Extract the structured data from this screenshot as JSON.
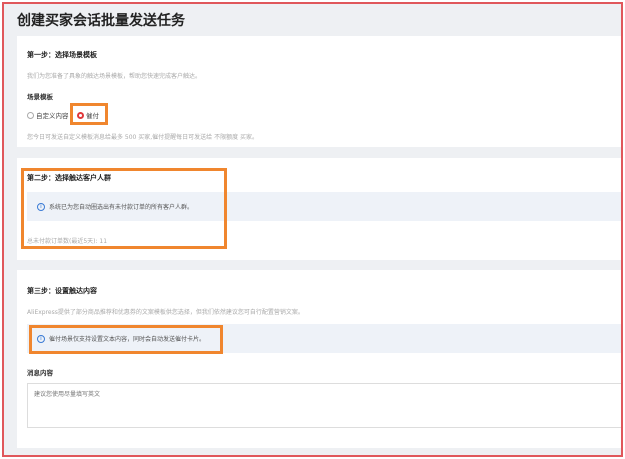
{
  "page": {
    "title": "创建买家会话批量发送任务"
  },
  "step1": {
    "title": "第一步：选择场景模板",
    "desc": "我们为您准备了具象的触达场景模板，帮助您快速完成客户触达。",
    "label": "场景模板",
    "options": [
      {
        "label": "自定义内容",
        "selected": false
      },
      {
        "label": "催付",
        "selected": true
      }
    ],
    "note": "您今日可发送自定义模板消息给最多 500 买家,催付提醒每日可发送给 不限额度 买家。"
  },
  "step2": {
    "title": "第二步：选择触达客户人群",
    "info": "系统已为您自动圈选出有未付款订单的所有客户人群。",
    "total": "总未付款订单数(最近5天): 11"
  },
  "step3": {
    "title": "第三步：设置触达内容",
    "desc": "AliExpress提供了部分商品推荐和优惠券的文案模板供您选择，但我们依然建议您可自行配置营销文案。",
    "info": "催付场景仅支持设置文本内容，同时会自动发送催付卡片。",
    "label": "消息内容",
    "placeholder": "建议您使用尽量填写英文"
  },
  "colors": {
    "highlight": "#f0862e",
    "frame": "#e0575b",
    "radio": "#e0373a"
  }
}
